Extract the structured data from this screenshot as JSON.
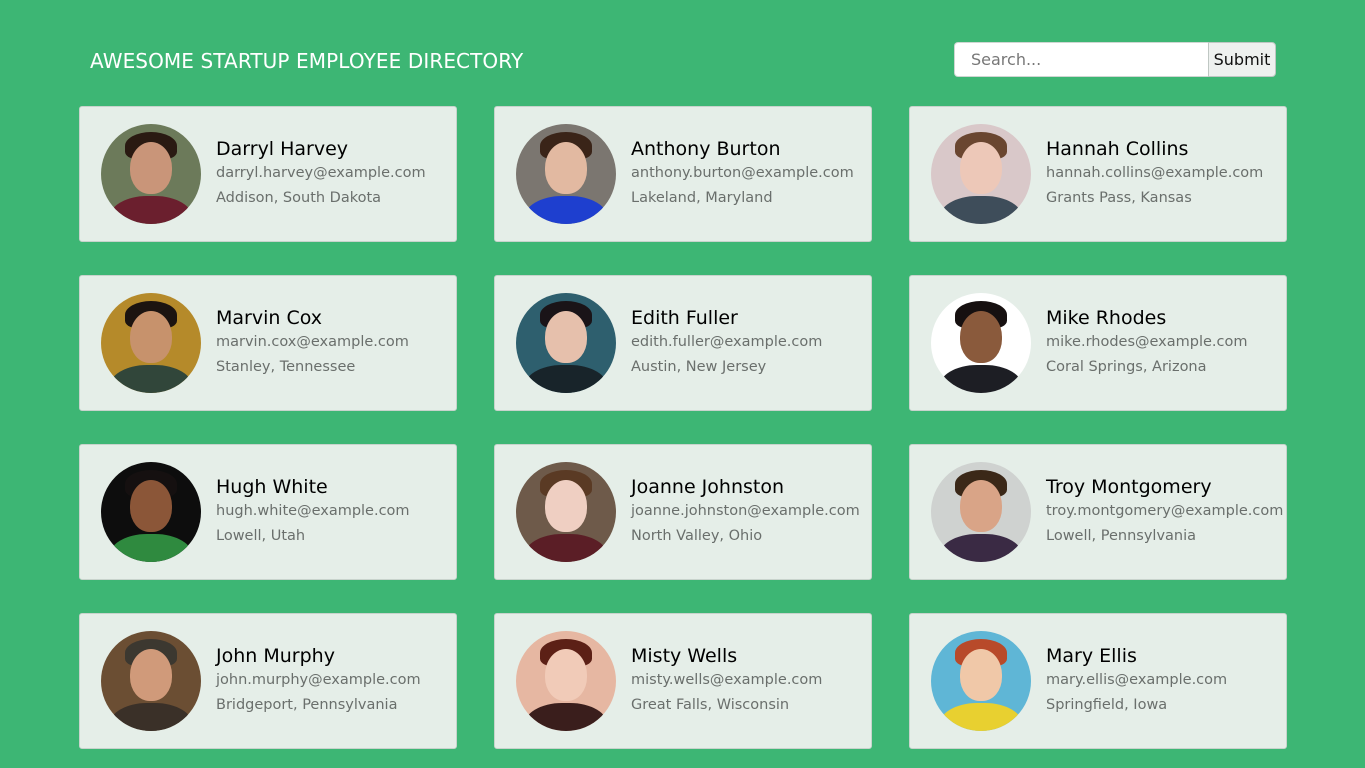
{
  "header": {
    "title": "AWESOME STARTUP EMPLOYEE DIRECTORY"
  },
  "search": {
    "placeholder": "Search...",
    "value": "",
    "submit_label": "Submit"
  },
  "employees": [
    {
      "name": "Darryl Harvey",
      "email": "darryl.harvey@example.com",
      "location": "Addison, South Dakota",
      "colors": {
        "bg": "#6c7a5a",
        "skin": "#c99579",
        "hair": "#2a1a12",
        "body": "#6b1f2e"
      }
    },
    {
      "name": "Anthony Burton",
      "email": "anthony.burton@example.com",
      "location": "Lakeland, Maryland",
      "colors": {
        "bg": "#7b7670",
        "skin": "#e2b9a1",
        "hair": "#3a2418",
        "body": "#1e3fcf"
      }
    },
    {
      "name": "Hannah Collins",
      "email": "hannah.collins@example.com",
      "location": "Grants Pass, Kansas",
      "colors": {
        "bg": "#d9c8c9",
        "skin": "#edc8b8",
        "hair": "#6a4630",
        "body": "#3e4d5a"
      }
    },
    {
      "name": "Marvin Cox",
      "email": "marvin.cox@example.com",
      "location": "Stanley, Tennessee",
      "colors": {
        "bg": "#b58a2a",
        "skin": "#c7926c",
        "hair": "#1c1410",
        "body": "#31463a"
      }
    },
    {
      "name": "Edith Fuller",
      "email": "edith.fuller@example.com",
      "location": "Austin, New Jersey",
      "colors": {
        "bg": "#2e5f6e",
        "skin": "#e6c0ac",
        "hair": "#1a1418",
        "body": "#18242a"
      }
    },
    {
      "name": "Mike Rhodes",
      "email": "mike.rhodes@example.com",
      "location": "Coral Springs, Arizona",
      "colors": {
        "bg": "#ffffff",
        "skin": "#8a5a3c",
        "hair": "#161010",
        "body": "#1d1e24"
      }
    },
    {
      "name": "Hugh White",
      "email": "hugh.white@example.com",
      "location": "Lowell, Utah",
      "colors": {
        "bg": "#0d0d0d",
        "skin": "#8b5638",
        "hair": "#151010",
        "body": "#2f8a3f"
      }
    },
    {
      "name": "Joanne Johnston",
      "email": "joanne.johnston@example.com",
      "location": "North Valley, Ohio",
      "colors": {
        "bg": "#6e5a4a",
        "skin": "#efcfc2",
        "hair": "#5a3a24",
        "body": "#5b1e26"
      }
    },
    {
      "name": "Troy Montgomery",
      "email": "troy.montgomery@example.com",
      "location": "Lowell, Pennsylvania",
      "colors": {
        "bg": "#cfd2d0",
        "skin": "#d9a487",
        "hair": "#3b2818",
        "body": "#3a2a44"
      }
    },
    {
      "name": "John Murphy",
      "email": "john.murphy@example.com",
      "location": "Bridgeport, Pennsylvania",
      "colors": {
        "bg": "#6b4e33",
        "skin": "#d09a7a",
        "hair": "#3c3830",
        "body": "#3a3028"
      }
    },
    {
      "name": "Misty Wells",
      "email": "misty.wells@example.com",
      "location": "Great Falls, Wisconsin",
      "colors": {
        "bg": "#e6b7a2",
        "skin": "#f1cbb8",
        "hair": "#5c2016",
        "body": "#3a1e1c"
      }
    },
    {
      "name": "Mary Ellis",
      "email": "mary.ellis@example.com",
      "location": "Springfield, Iowa",
      "colors": {
        "bg": "#5fb6d6",
        "skin": "#f0c8a8",
        "hair": "#b84a2a",
        "body": "#e8d030"
      }
    }
  ]
}
